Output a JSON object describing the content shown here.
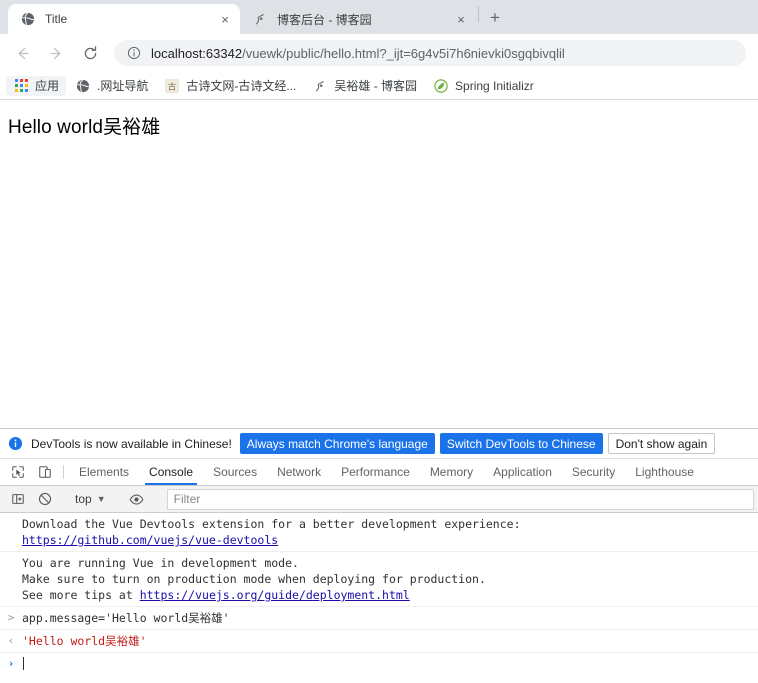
{
  "browser": {
    "tabs": [
      {
        "title": "Title",
        "favicon": "globe-icon",
        "active": true,
        "close_label": "×"
      },
      {
        "title": "博客后台 - 博客园",
        "favicon": "cnblogs-icon",
        "active": false,
        "close_label": "×"
      }
    ],
    "new_tab_label": "+",
    "nav": {
      "back_label": "←",
      "forward_label": "→",
      "reload_label": "⟳"
    },
    "omnibox": {
      "info_icon": "info-circle-icon",
      "host": "localhost:63342",
      "path": "/vuewk/public/hello.html?_ijt=6g4v5i7h6nievki0sgqbivqlil",
      "full_url": "localhost:63342/vuewk/public/hello.html?_ijt=6g4v5i7h6nievki0sgqbivqlil"
    },
    "bookmarks": [
      {
        "label": "应用",
        "icon": "apps-grid-icon"
      },
      {
        "label": ".网址导航",
        "icon": "globe-icon"
      },
      {
        "label": "古诗文网-古诗文经...",
        "icon": "gushiwen-icon"
      },
      {
        "label": "吴裕雄 - 博客园",
        "icon": "cnblogs-icon"
      },
      {
        "label": "Spring Initializr",
        "icon": "spring-leaf-icon"
      }
    ]
  },
  "page": {
    "heading": "Hello world吴裕雄"
  },
  "devtools": {
    "notice": {
      "icon": "info-circle-icon",
      "text": "DevTools is now available in Chinese!",
      "primary_button": "Always match Chrome's language",
      "secondary_button": "Switch DevTools to Chinese",
      "dismiss_button": "Don't show again"
    },
    "inspect_icon": "inspect-element-icon",
    "device_icon": "device-toolbar-icon",
    "tabs": [
      {
        "label": "Elements",
        "active": false
      },
      {
        "label": "Console",
        "active": true
      },
      {
        "label": "Sources",
        "active": false
      },
      {
        "label": "Network",
        "active": false
      },
      {
        "label": "Performance",
        "active": false
      },
      {
        "label": "Memory",
        "active": false
      },
      {
        "label": "Application",
        "active": false
      },
      {
        "label": "Security",
        "active": false
      },
      {
        "label": "Lighthouse",
        "active": false
      }
    ],
    "console_toolbar": {
      "sidebar_icon": "console-sidebar-icon",
      "clear_icon": "clear-console-icon",
      "context_value": "top",
      "context_caret": "▼",
      "eye_icon": "live-expression-icon",
      "filter_placeholder": "Filter",
      "filter_value": ""
    },
    "console_messages": [
      {
        "gutter": "",
        "gutter_style": "none",
        "lines": [
          {
            "text": "Download the Vue Devtools extension for a better development experience:",
            "style": "plain"
          },
          {
            "text": "https://github.com/vuejs/vue-devtools",
            "style": "link"
          }
        ]
      },
      {
        "gutter": "",
        "gutter_style": "none",
        "lines": [
          {
            "text": "You are running Vue in development mode.",
            "style": "plain"
          },
          {
            "text": "Make sure to turn on production mode when deploying for production.",
            "style": "plain"
          },
          {
            "text": "See more tips at ",
            "style": "plain",
            "link_text": "https://vuejs.org/guide/deployment.html"
          }
        ]
      },
      {
        "gutter": ">",
        "gutter_style": "gray",
        "lines": [
          {
            "text": "app.message='Hello world吴裕雄'",
            "style": "expression"
          }
        ]
      },
      {
        "gutter": "‹",
        "gutter_style": "gray",
        "lines": [
          {
            "text": "'Hello world吴裕雄'",
            "style": "string"
          }
        ]
      }
    ],
    "prompt": {
      "gutter": "›",
      "value": ""
    }
  },
  "colors": {
    "accent_blue": "#1a73e8",
    "tabstrip_bg": "#dee1e6",
    "omnibox_bg": "#f1f3f4",
    "string_red": "#c41a16",
    "link_blue": "#1a0dab"
  }
}
